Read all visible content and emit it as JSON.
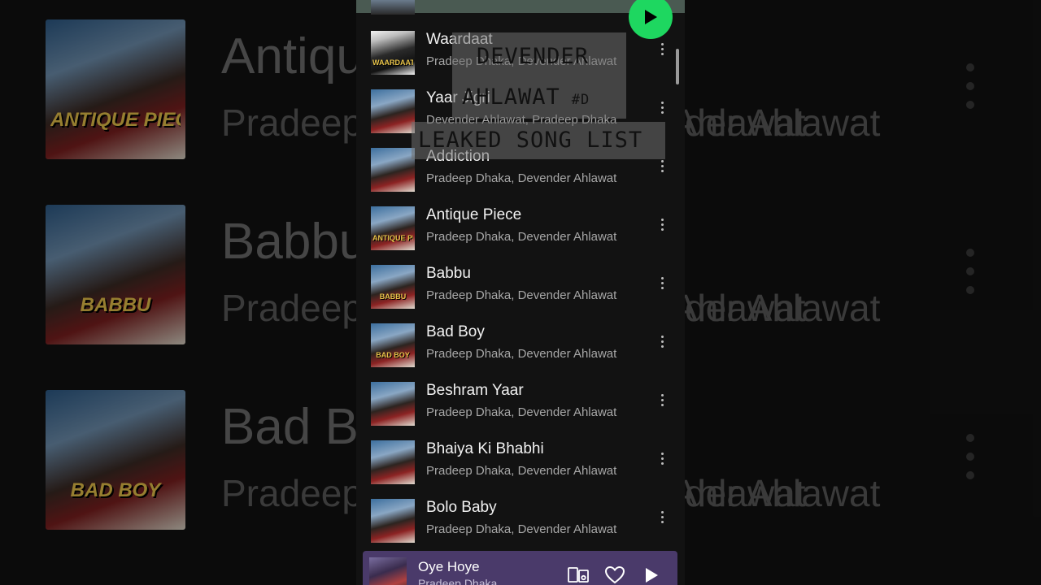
{
  "background": {
    "rows": [
      {
        "title": "Antique Piece",
        "subtitle_left": "Pradeep Dhaka, Devender Ahlawat",
        "art_label": "ANTIQUE PIECE"
      },
      {
        "title": "Babbu",
        "subtitle_left": "Pradeep Dhaka, Devender Ahlawat",
        "art_label": "BABBU"
      },
      {
        "title": "Bad Boy",
        "subtitle_left": "Pradeep Dhaka, Devender Ahlawat",
        "art_label": "BAD BOY"
      }
    ],
    "subtitle_right": "der Ahlawat"
  },
  "overlay": {
    "line1": "DEVENDER",
    "line2": "AHLAWAT",
    "line2_suffix": "#D",
    "line3": "LEAKED SONG LIST"
  },
  "tracks": [
    {
      "title": "Waardaat",
      "artist": "Pradeep Dhaka, Devender Ahlawat",
      "art": "bw",
      "art_label": "WAARDAAT"
    },
    {
      "title": "Yaar Jigri",
      "artist": "Devender Ahlawat, Pradeep Dhaka",
      "art": "color",
      "art_label": ""
    },
    {
      "title": "Addiction",
      "artist": "Pradeep Dhaka, Devender Ahlawat",
      "art": "color",
      "art_label": ""
    },
    {
      "title": "Antique Piece",
      "artist": "Pradeep Dhaka, Devender Ahlawat",
      "art": "color",
      "art_label": "ANTIQUE PIECE"
    },
    {
      "title": "Babbu",
      "artist": "Pradeep Dhaka, Devender Ahlawat",
      "art": "color",
      "art_label": "BABBU"
    },
    {
      "title": "Bad Boy",
      "artist": "Pradeep Dhaka, Devender Ahlawat",
      "art": "color",
      "art_label": "BAD BOY"
    },
    {
      "title": "Beshram Yaar",
      "artist": "Pradeep Dhaka, Devender Ahlawat",
      "art": "color",
      "art_label": ""
    },
    {
      "title": "Bhaiya Ki Bhabhi",
      "artist": "Pradeep Dhaka, Devender Ahlawat",
      "art": "color",
      "art_label": ""
    },
    {
      "title": "Bolo Baby",
      "artist": "Pradeep Dhaka, Devender Ahlawat",
      "art": "color",
      "art_label": ""
    }
  ],
  "now_playing": {
    "title": "Oye Hoye",
    "artist": "Pradeep Dhaka"
  },
  "colors": {
    "accent": "#1ed760",
    "background": "#121212",
    "mini_player": "#4a3a6a"
  },
  "icons": {
    "play_fab": "play-icon",
    "track_menu": "more-vertical-icon",
    "devices": "devices-icon",
    "like": "heart-icon",
    "mini_play": "play-icon"
  }
}
